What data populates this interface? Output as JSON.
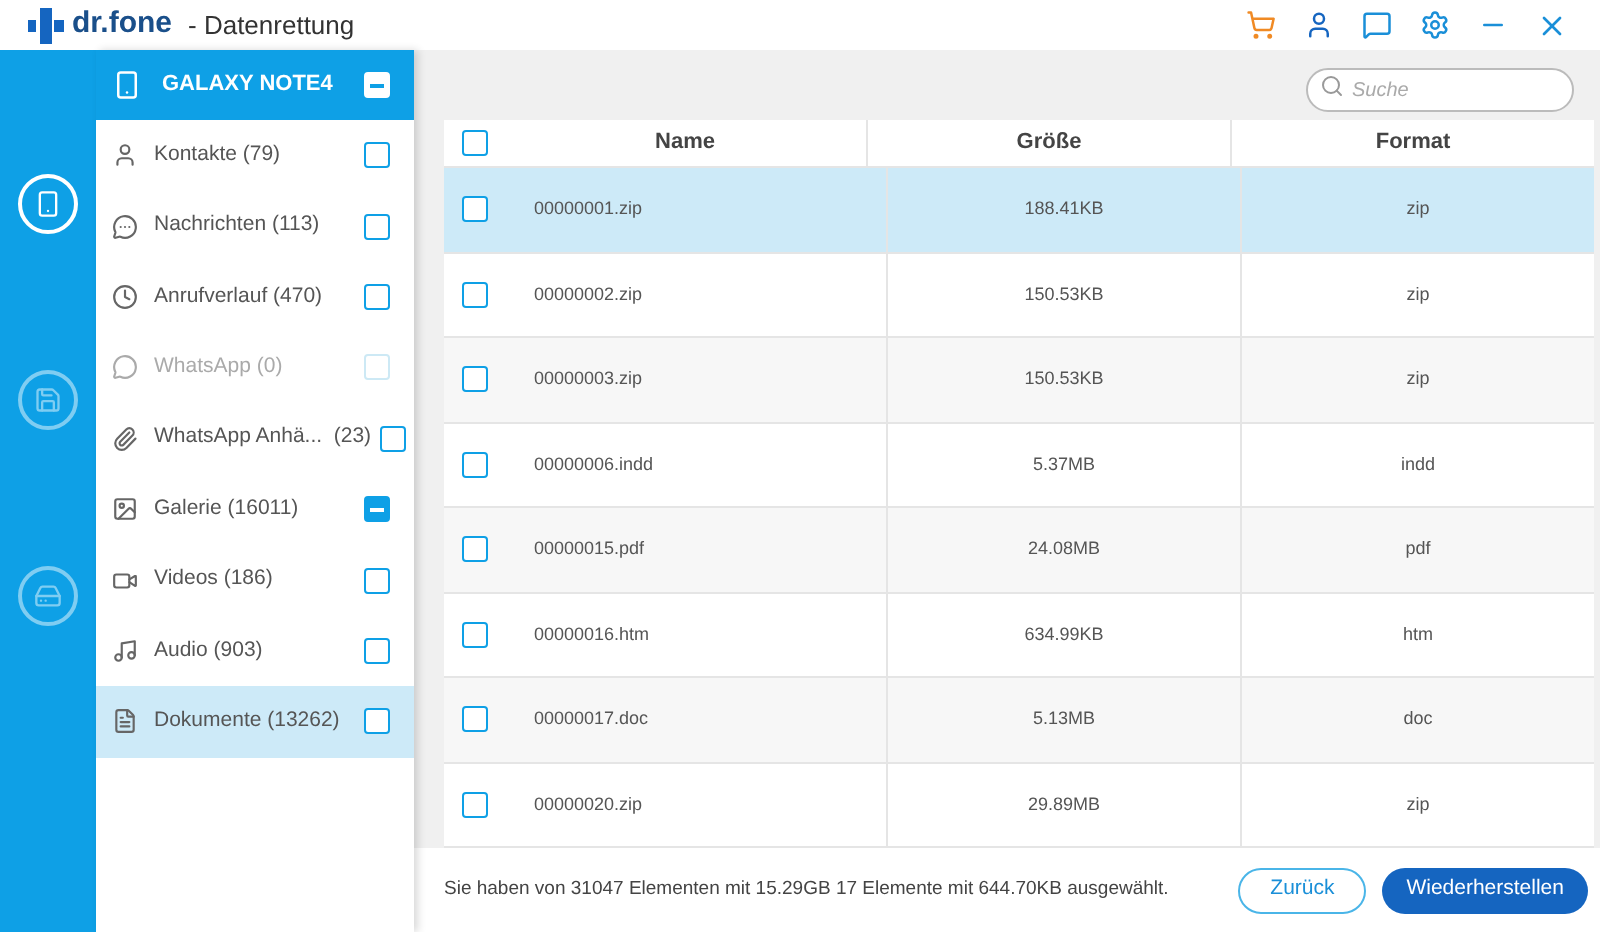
{
  "window": {
    "brand": "dr.fone",
    "title": "- Datenrettung"
  },
  "rail": [
    {
      "kind": "phone",
      "selected": true
    },
    {
      "kind": "sdcard",
      "selected": false
    },
    {
      "kind": "backup",
      "selected": false
    }
  ],
  "device": {
    "name": "GALAXY NOTE4",
    "indeterminate": true
  },
  "categories": [
    {
      "kind": "contacts",
      "label": "Kontakte (79)",
      "indeterminate": false,
      "disabled": false,
      "selected": false
    },
    {
      "kind": "messages",
      "label": "Nachrichten (113)",
      "indeterminate": false,
      "disabled": false,
      "selected": false
    },
    {
      "kind": "calls",
      "label": "Anrufverlauf (470)",
      "indeterminate": false,
      "disabled": false,
      "selected": false
    },
    {
      "kind": "whatsapp",
      "label": "WhatsApp (0)",
      "indeterminate": false,
      "disabled": true,
      "selected": false
    },
    {
      "kind": "attachments",
      "label": "WhatsApp Anhä...  (23)",
      "indeterminate": false,
      "disabled": false,
      "selected": false
    },
    {
      "kind": "gallery",
      "label": "Galerie (16011)",
      "indeterminate": true,
      "disabled": false,
      "selected": false
    },
    {
      "kind": "videos",
      "label": "Videos (186)",
      "indeterminate": false,
      "disabled": false,
      "selected": false
    },
    {
      "kind": "audio",
      "label": "Audio (903)",
      "indeterminate": false,
      "disabled": false,
      "selected": false
    },
    {
      "kind": "documents",
      "label": "Dokumente (13262)",
      "indeterminate": false,
      "disabled": false,
      "selected": true
    }
  ],
  "search": {
    "placeholder": "Suche"
  },
  "table": {
    "all_checked": false,
    "columns": [
      "Name",
      "Größe",
      "Format"
    ],
    "rows": [
      {
        "name": "00000001.zip",
        "size": "188.41KB",
        "format": "zip",
        "selected": true
      },
      {
        "name": "00000002.zip",
        "size": "150.53KB",
        "format": "zip",
        "selected": false
      },
      {
        "name": "00000003.zip",
        "size": "150.53KB",
        "format": "zip",
        "selected": false
      },
      {
        "name": "00000006.indd",
        "size": "5.37MB",
        "format": "indd",
        "selected": false
      },
      {
        "name": "00000015.pdf",
        "size": "24.08MB",
        "format": "pdf",
        "selected": false
      },
      {
        "name": "00000016.htm",
        "size": "634.99KB",
        "format": "htm",
        "selected": false
      },
      {
        "name": "00000017.doc",
        "size": "5.13MB",
        "format": "doc",
        "selected": false
      },
      {
        "name": "00000020.zip",
        "size": "29.89MB",
        "format": "zip",
        "selected": false
      }
    ]
  },
  "status": "Sie haben von 31047 Elementen mit 15.29GB 17 Elemente mit 644.70KB ausgewählt.",
  "buttons": [
    {
      "kind": "secondary",
      "label": "Zurück"
    },
    {
      "kind": "primary",
      "label": "Wiederherstellen"
    }
  ]
}
